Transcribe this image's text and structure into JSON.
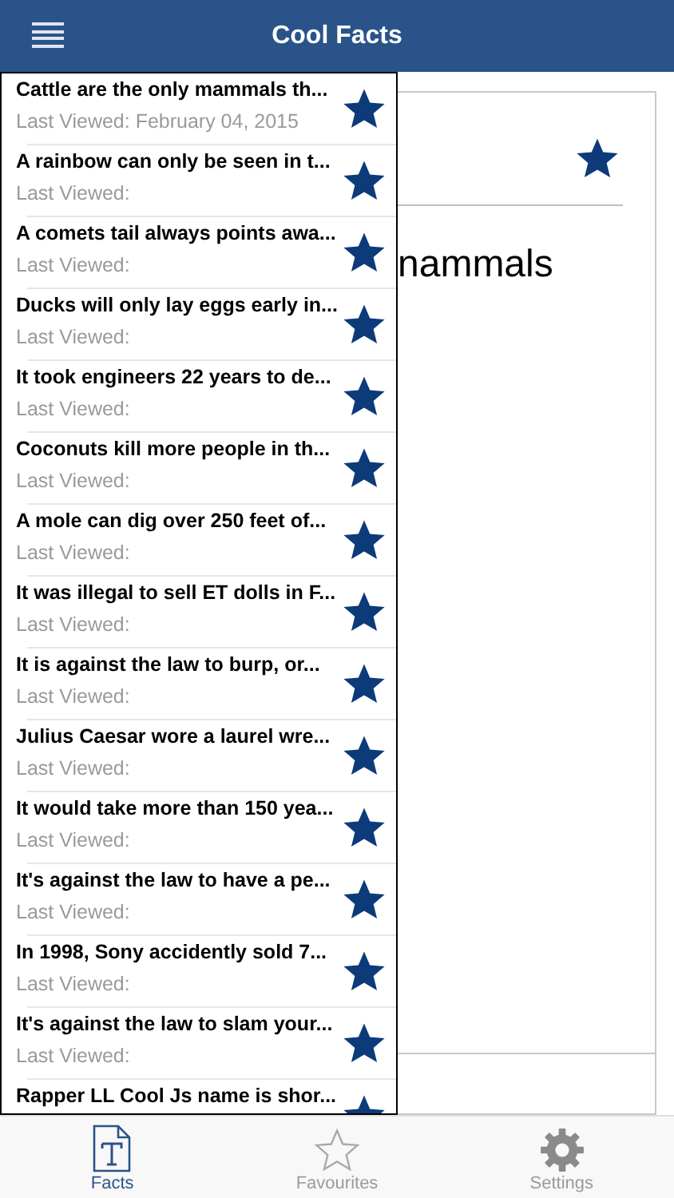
{
  "nav_bar": {
    "title": "Cool Facts"
  },
  "detail_card": {
    "text_fragment": "nammals",
    "favourite": true
  },
  "facts_list": [
    {
      "title": "Cattle are the only mammals th...",
      "subtitle": "Last Viewed: February 04, 2015",
      "favourite": true
    },
    {
      "title": "A rainbow can only be seen in t...",
      "subtitle": "Last Viewed:",
      "favourite": true
    },
    {
      "title": "A comets tail always points awa...",
      "subtitle": "Last Viewed:",
      "favourite": true
    },
    {
      "title": "Ducks will only lay eggs early in...",
      "subtitle": "Last Viewed:",
      "favourite": true
    },
    {
      "title": "It took engineers 22 years to de...",
      "subtitle": "Last Viewed:",
      "favourite": true
    },
    {
      "title": "Coconuts kill more people in th...",
      "subtitle": "Last Viewed:",
      "favourite": true
    },
    {
      "title": "A mole can dig over 250 feet of...",
      "subtitle": "Last Viewed:",
      "favourite": true
    },
    {
      "title": "It was illegal to sell ET dolls in F...",
      "subtitle": "Last Viewed:",
      "favourite": true
    },
    {
      "title": "It is against the law to burp, or...",
      "subtitle": "Last Viewed:",
      "favourite": true
    },
    {
      "title": "Julius Caesar wore a laurel wre...",
      "subtitle": "Last Viewed:",
      "favourite": true
    },
    {
      "title": "It would take more than 150 yea...",
      "subtitle": "Last Viewed:",
      "favourite": true
    },
    {
      "title": "It's against the law to have a pe...",
      "subtitle": "Last Viewed:",
      "favourite": true
    },
    {
      "title": "In 1998, Sony accidently sold 7...",
      "subtitle": "Last Viewed:",
      "favourite": true
    },
    {
      "title": "It's against the law to slam your...",
      "subtitle": "Last Viewed:",
      "favourite": true
    },
    {
      "title": "Rapper LL Cool Js name is shor...",
      "favourite": true
    }
  ],
  "tab_bar": [
    {
      "kind": "facts",
      "label": "Facts",
      "selected": true
    },
    {
      "kind": "favourites",
      "label": "Favourites",
      "selected": false
    },
    {
      "kind": "settings",
      "label": "Settings",
      "selected": false
    }
  ]
}
